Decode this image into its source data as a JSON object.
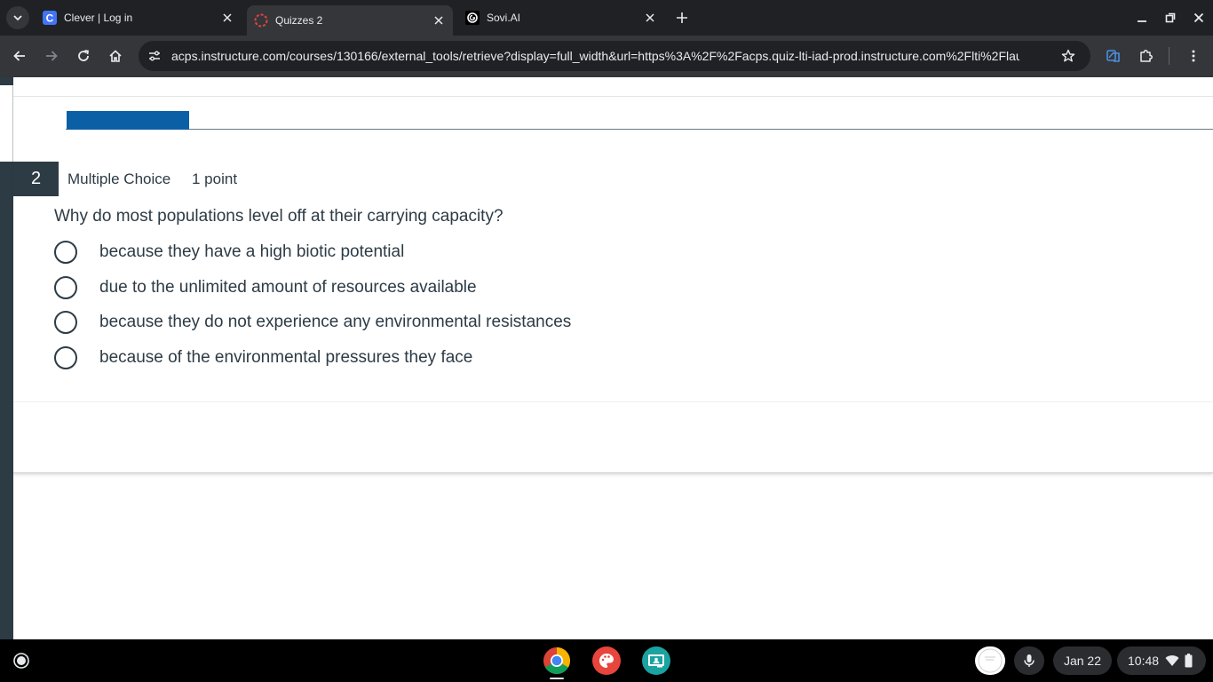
{
  "browser": {
    "tabs": [
      {
        "title": "Clever | Log in",
        "favicon_letter": "C",
        "active": false
      },
      {
        "title": "Quizzes 2",
        "active": true
      },
      {
        "title": "Sovi.AI",
        "active": false
      }
    ],
    "omnibox": {
      "url_host": "acps.instructure.com",
      "url_path": "/courses/130166/external_tools/retrieve?display=full_width&url=https%3A%2F%2Facps.quiz-lti-iad-prod.instructure.com%2Flti%2Flaun…"
    }
  },
  "quiz": {
    "progress_fraction": 0.107,
    "question": {
      "number": "2",
      "type": "Multiple Choice",
      "points": "1 point",
      "text": "Why do most populations level off at their carrying capacity?",
      "options": [
        "because they have a high biotic potential",
        "due to the unlimited amount of resources available",
        "because they do not experience any environmental resistances",
        "because of the environmental pressures they face"
      ]
    }
  },
  "shelf": {
    "date": "Jan 22",
    "time": "10:48"
  },
  "colors": {
    "canvas_navy": "#2d3b45",
    "progress_blue": "#0b5fa5",
    "chrome_dark": "#202124",
    "chrome_toolbar": "#35363a",
    "clever_blue": "#4274f6",
    "quizzes_red": "#e0463d"
  },
  "icons": {
    "tab_search": "chevron-down-icon",
    "tab_close": "close-icon",
    "new_tab": "plus-icon",
    "back": "arrow-left-icon",
    "forward": "arrow-right-icon",
    "reload": "reload-icon",
    "home": "home-icon",
    "site_info": "tune-icon",
    "bookmark": "star-icon",
    "extensions": "puzzle-icon",
    "menu": "kebab-icon",
    "mic": "mic-icon",
    "wifi": "wifi-icon",
    "battery": "battery-icon"
  }
}
